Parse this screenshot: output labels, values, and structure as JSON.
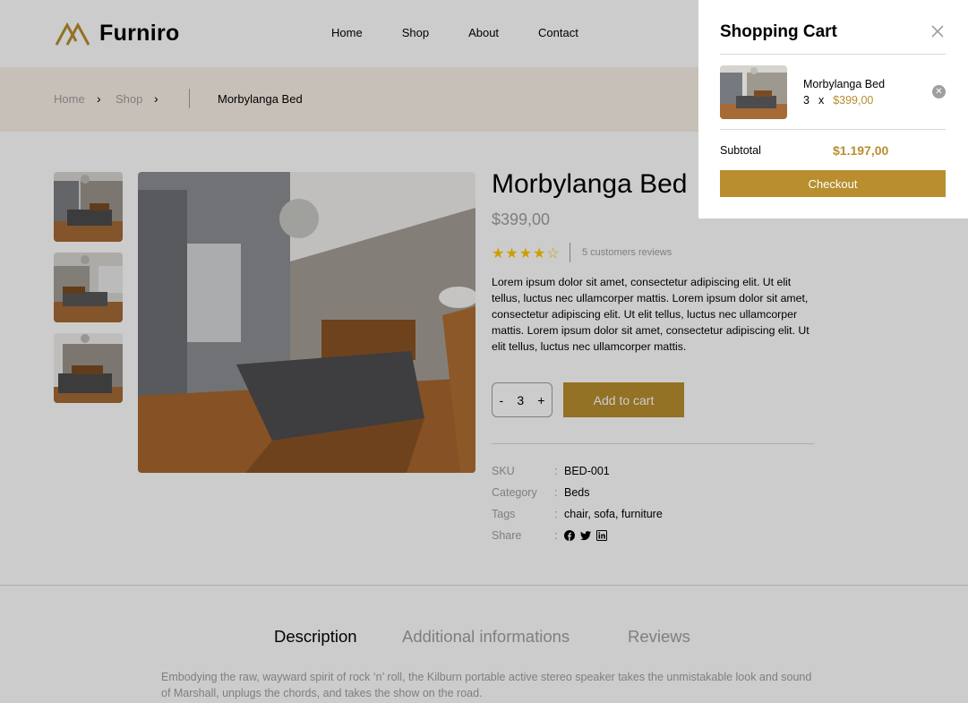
{
  "header": {
    "logo_text": "Furniro",
    "nav": [
      "Home",
      "Shop",
      "About",
      "Contact"
    ]
  },
  "breadcrumb": {
    "items": [
      "Home",
      "Shop"
    ],
    "current": "Morbylanga Bed"
  },
  "product": {
    "title": "Morbylanga Bed",
    "price": "$399,00",
    "rating": 4,
    "stars": "★★★★☆",
    "reviews": "5 customers reviews",
    "description": "Lorem ipsum dolor sit amet, consectetur adipiscing elit. Ut elit tellus, luctus nec ullamcorper mattis. Lorem ipsum dolor sit amet, consectetur adipiscing elit. Ut elit tellus, luctus nec ullamcorper mattis. Lorem ipsum dolor sit amet, consectetur adipiscing elit. Ut elit tellus, luctus nec ullamcorper mattis.",
    "qty_minus": "-",
    "qty_value": "3",
    "qty_plus": "+",
    "add_to_cart": "Add to cart",
    "meta": [
      {
        "key": "SKU",
        "value": "BED-001"
      },
      {
        "key": "Category",
        "value": "Beds"
      },
      {
        "key": "Tags",
        "value": "chair, sofa, furniture"
      },
      {
        "key": "Share",
        "value": ""
      }
    ],
    "separator": ":"
  },
  "tabs": [
    {
      "label": "Description",
      "active": true
    },
    {
      "label": "Additional informations",
      "active": false
    },
    {
      "label": "Reviews",
      "active": false
    }
  ],
  "long_description": "Embodying the raw, wayward spirit of rock ‘n’ roll, the Kilburn portable active stereo speaker takes the unmistakable look and sound of Marshall, unplugs the chords, and takes the show on the road.",
  "cart": {
    "title": "Shopping Cart",
    "item": {
      "name": "Morbylanga Bed",
      "qty": "3",
      "x": "x",
      "price": "$399,00"
    },
    "subtotal_label": "Subtotal",
    "subtotal_value": "$1.197,00",
    "checkout_label": "Checkout"
  },
  "colors": {
    "accent": "#b88e2f",
    "breadcrumb_bg": "#f9f1e7",
    "muted": "#9f9f9f",
    "star": "#ffc700"
  },
  "icons": [
    "logo-icon",
    "chevron-right-icon",
    "close-icon",
    "remove-icon",
    "facebook-icon",
    "twitter-icon",
    "linkedin-icon"
  ]
}
